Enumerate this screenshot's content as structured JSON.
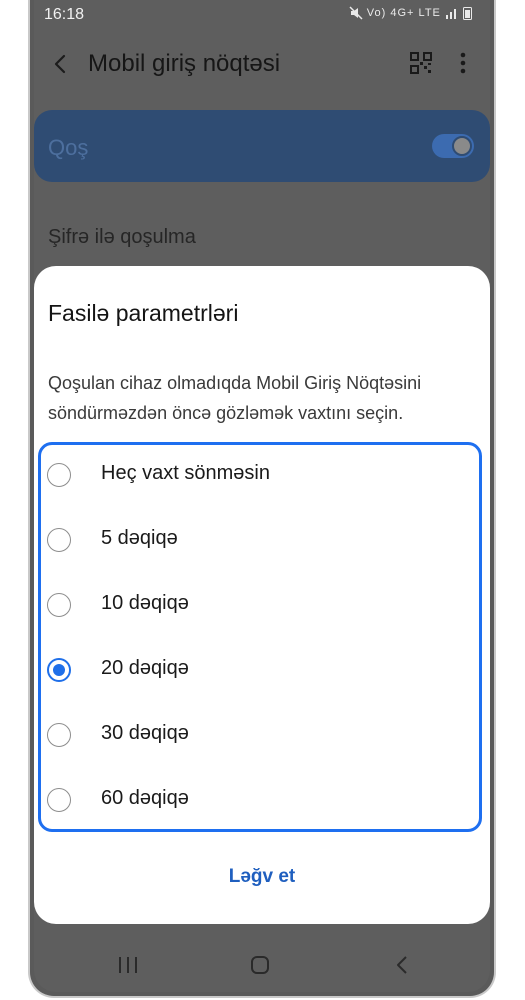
{
  "status_bar": {
    "time": "16:18",
    "network_label": "Vo) 4G+ LTE"
  },
  "app_bar": {
    "title": "Mobil giriş nöqtəsi",
    "back_icon": "back-arrow-icon",
    "qr_icon": "qr-code-icon",
    "more_icon": "more-vert-icon"
  },
  "background": {
    "toggle_label": "Qoş",
    "toggle_on": true,
    "row_label": "Şifrə ilə qoşulma"
  },
  "dialog": {
    "title": "Fasilə parametrləri",
    "description": "Qoşulan cihaz olmadıqda Mobil Giriş Nöqtəsini söndürməzdən öncə gözləmək vaxtını seçin.",
    "options": [
      {
        "label": "Heç vaxt sönməsin",
        "selected": false
      },
      {
        "label": "5 dəqiqə",
        "selected": false
      },
      {
        "label": "10 dəqiqə",
        "selected": false
      },
      {
        "label": "20 dəqiqə",
        "selected": true
      },
      {
        "label": "30 dəqiqə",
        "selected": false
      },
      {
        "label": "60 dəqiqə",
        "selected": false
      }
    ],
    "cancel_label": "Ləğv et"
  },
  "colors": {
    "accent": "#1f6fe9",
    "highlight_border": "#1e6ff0",
    "scrim": "#5e5e5e"
  }
}
